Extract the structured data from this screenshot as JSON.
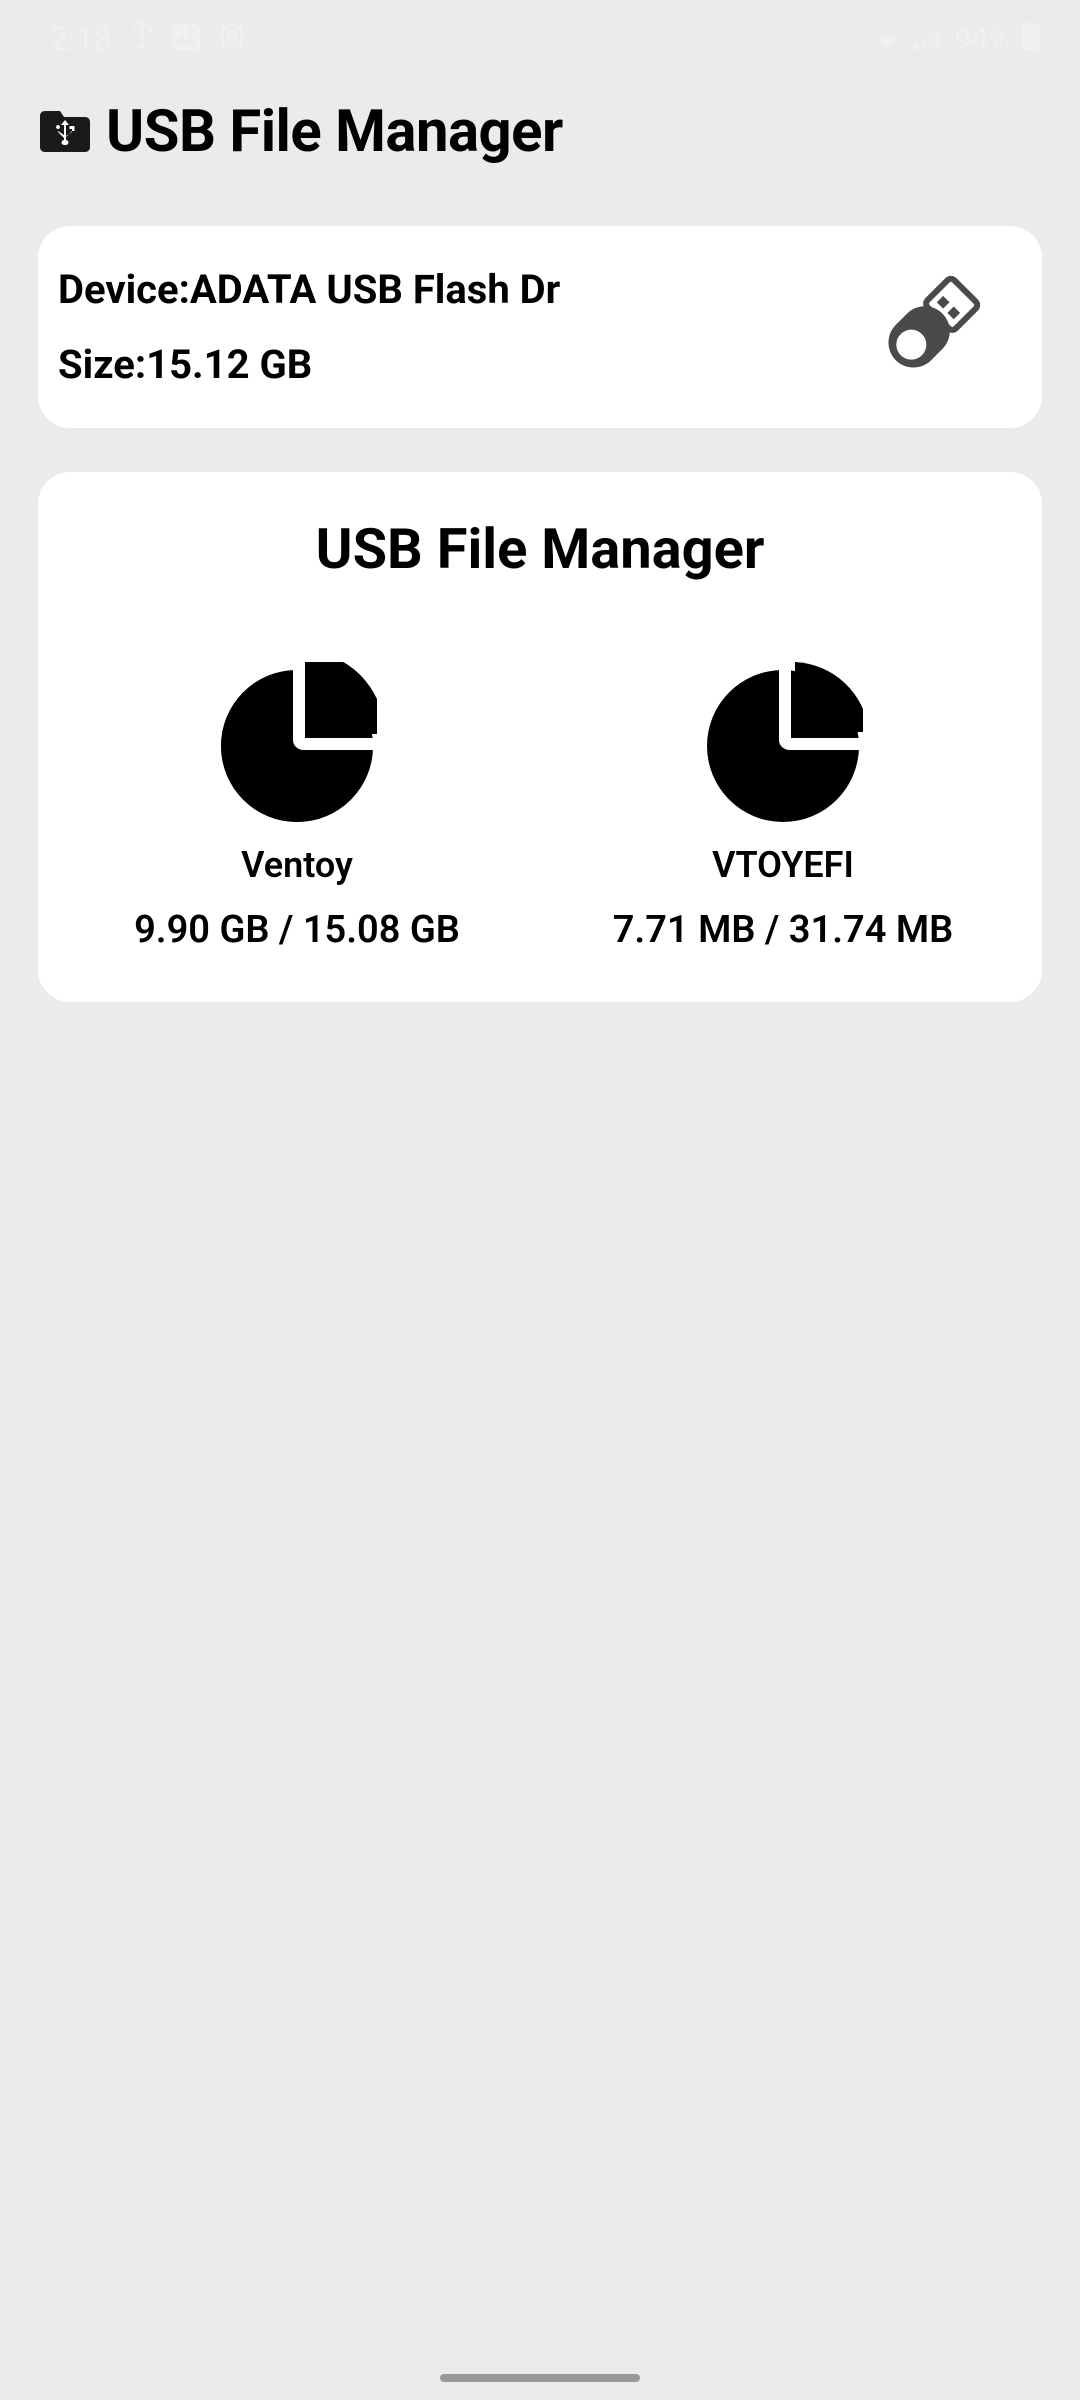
{
  "status_bar": {
    "time": "2:18",
    "battery_text": "94%"
  },
  "header": {
    "title": "USB File Manager"
  },
  "device": {
    "label_prefix": "Device:",
    "name": "ADATA USB Flash Dr",
    "size_prefix": "Size:",
    "size": "15.12 GB"
  },
  "partitions": {
    "title": "USB File Manager",
    "items": [
      {
        "name": "Ventoy",
        "size": "9.90 GB / 15.08 GB"
      },
      {
        "name": "VTOYEFI",
        "size": "7.71 MB / 31.74 MB"
      }
    ]
  }
}
